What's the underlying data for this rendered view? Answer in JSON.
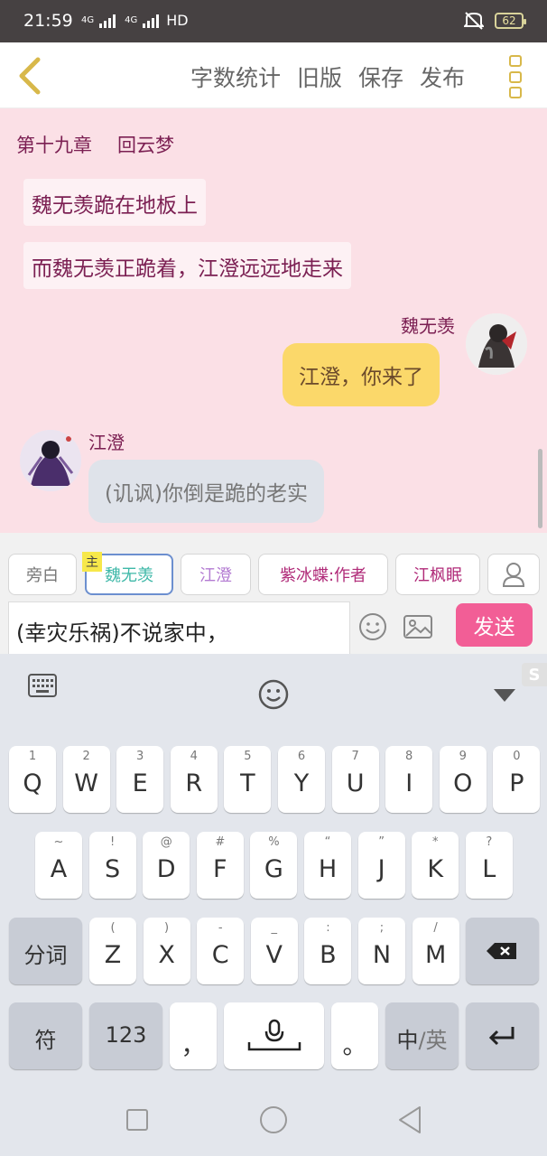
{
  "status_bar": {
    "time": "21:59",
    "network_1": "4G",
    "network_2": "4G",
    "hd": "HD",
    "battery": "62"
  },
  "header": {
    "actions": [
      "字数统计",
      "旧版",
      "保存",
      "发布"
    ],
    "accent": "#d8b84a"
  },
  "story": {
    "chapter_number": "第十九章",
    "chapter_title": "回云梦",
    "narrations": [
      "魏无羡跪在地板上",
      "而魏无羡正跪着，江澄远远地走来"
    ],
    "messages": [
      {
        "name": "魏无羡",
        "text": "江澄，你来了",
        "side": "right"
      },
      {
        "name": "江澄",
        "text": "(讥讽)你倒是跪的老实",
        "side": "left"
      }
    ]
  },
  "roles": {
    "items": [
      {
        "label": "旁白",
        "color": "#777777"
      },
      {
        "label": "魏无羡",
        "color": "#3fb8a8",
        "main_tag": "主"
      },
      {
        "label": "江澄",
        "color": "#b37bd2"
      },
      {
        "label": "紫冰蝶:作者",
        "color": "#b02a78"
      },
      {
        "label": "江枫眠",
        "color": "#b02a78"
      }
    ]
  },
  "composer": {
    "input_value": "(幸灾乐祸)不说家中，",
    "send_label": "发送",
    "send_color": "#f25e96"
  },
  "keyboard": {
    "row1": [
      {
        "hint": "1",
        "key": "Q"
      },
      {
        "hint": "2",
        "key": "W"
      },
      {
        "hint": "3",
        "key": "E"
      },
      {
        "hint": "4",
        "key": "R"
      },
      {
        "hint": "5",
        "key": "T"
      },
      {
        "hint": "6",
        "key": "Y"
      },
      {
        "hint": "7",
        "key": "U"
      },
      {
        "hint": "8",
        "key": "I"
      },
      {
        "hint": "9",
        "key": "O"
      },
      {
        "hint": "0",
        "key": "P"
      }
    ],
    "row2": [
      {
        "hint": "~",
        "key": "A"
      },
      {
        "hint": "!",
        "key": "S"
      },
      {
        "hint": "@",
        "key": "D"
      },
      {
        "hint": "#",
        "key": "F"
      },
      {
        "hint": "%",
        "key": "G"
      },
      {
        "hint": "“",
        "key": "H"
      },
      {
        "hint": "”",
        "key": "J"
      },
      {
        "hint": "*",
        "key": "K"
      },
      {
        "hint": "?",
        "key": "L"
      }
    ],
    "row3": [
      {
        "hint": "(",
        "key": "Z"
      },
      {
        "hint": ")",
        "key": "X"
      },
      {
        "hint": "-",
        "key": "C"
      },
      {
        "hint": "_",
        "key": "V"
      },
      {
        "hint": ":",
        "key": "B"
      },
      {
        "hint": ";",
        "key": "N"
      },
      {
        "hint": "/",
        "key": "M"
      }
    ],
    "fenci": "分词",
    "fu": "符",
    "num": "123",
    "comma": "，",
    "period": "。",
    "lang_zh": "中",
    "lang_sep": "/",
    "lang_en": "英",
    "corner_badge": "S"
  }
}
